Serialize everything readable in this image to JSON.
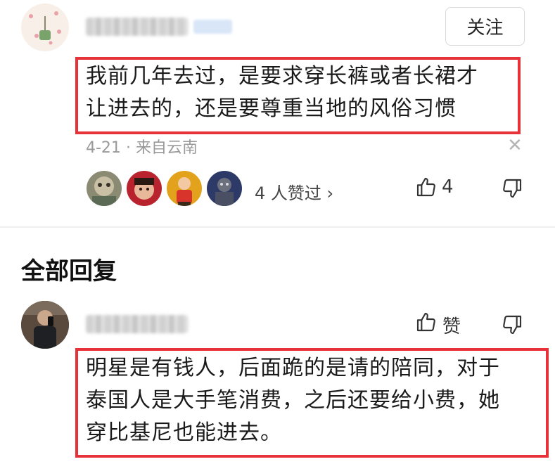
{
  "top_comment": {
    "follow_label": "关注",
    "text_line1": "我前几年去过，是要求穿长裤或者长裙才",
    "text_line2": "让进去的，还是要尊重当地的风俗习惯",
    "date": "4-21",
    "separator": "·",
    "location": "来自云南",
    "close_symbol": "✕",
    "likers_text": "4 人赞过",
    "likers_chevron": "›",
    "like_count": "4"
  },
  "section": {
    "title": "全部回复"
  },
  "reply": {
    "like_label": "赞",
    "text_line1": "明星是有钱人，后面跪的是请的陪同，对于",
    "text_line2": "泰国人是大手笔消费，之后还要给小费，她",
    "text_line3": "穿比基尼也能进去。"
  },
  "colors": {
    "highlight_border": "#e8323a",
    "meta_gray": "#9a9a9a"
  },
  "icons": {
    "thumb_up": "thumb-up-icon",
    "thumb_down": "thumb-down-icon",
    "close": "close-icon"
  }
}
